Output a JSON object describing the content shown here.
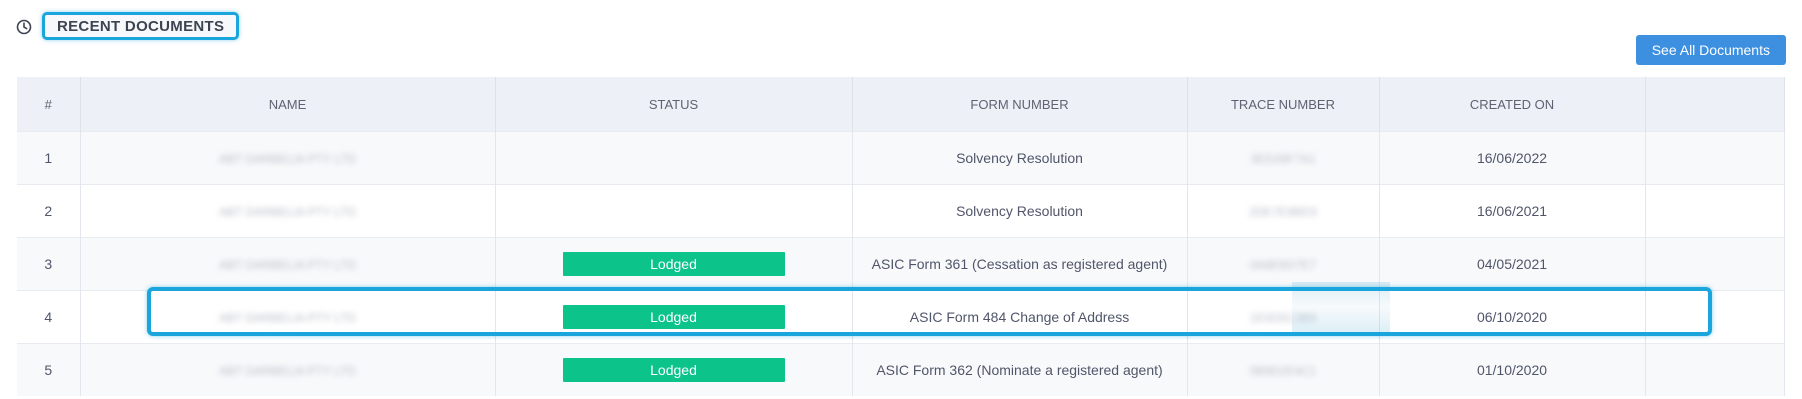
{
  "header": {
    "title": "RECENT DOCUMENTS",
    "icon": "clock-icon",
    "see_all_label": "See All Documents"
  },
  "table": {
    "columns": [
      "#",
      "NAME",
      "STATUS",
      "FORM NUMBER",
      "TRACE NUMBER",
      "CREATED ON",
      ""
    ],
    "rows": [
      {
        "num": "1",
        "name": "ABT DARBELIA PTY LTD",
        "status": "",
        "form": "Solvency Resolution",
        "trace": "3ED28F7A1",
        "created": "16/06/2022"
      },
      {
        "num": "2",
        "name": "ABT DARBELIA PTY LTD",
        "status": "",
        "form": "Solvency Resolution",
        "trace": "2DE7E9BD3",
        "created": "16/06/2021"
      },
      {
        "num": "3",
        "name": "ABT DARBELIA PTY LTD",
        "status": "Lodged",
        "form": "ASIC Form 361 (Cessation as registered agent)",
        "trace": "0A8E6D7E7",
        "created": "04/05/2021"
      },
      {
        "num": "4",
        "name": "ABT DARBELIA PTY LTD",
        "status": "Lodged",
        "form": "ASIC Form 484 Change of Address",
        "trace": "1E0D5C3B9",
        "created": "06/10/2020"
      },
      {
        "num": "5",
        "name": "ABT DARBELIA PTY LTD",
        "status": "Lodged",
        "form": "ASIC Form 362 (Nominate a registered agent)",
        "trace": "0B9D2E4C1",
        "created": "01/10/2020"
      }
    ]
  },
  "colors": {
    "accent": "#3d8fe0",
    "status_lodged": "#0cc48a",
    "highlight": "#1aa5dc"
  }
}
